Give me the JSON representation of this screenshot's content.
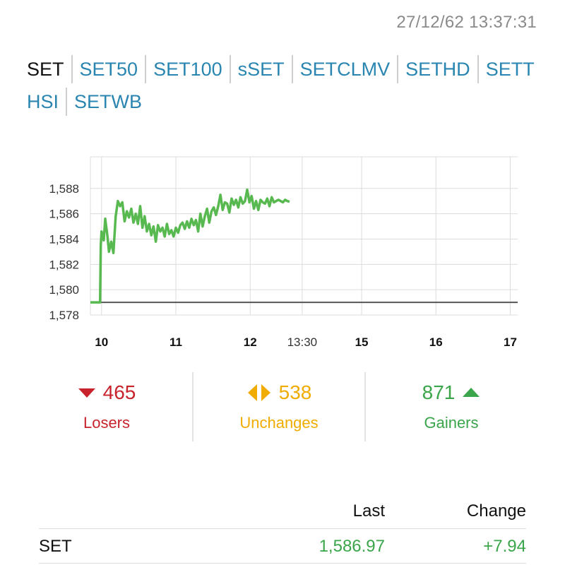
{
  "timestamp": "27/12/62 13:37:31",
  "tabs": [
    "SET",
    "SET50",
    "SET100",
    "sSET",
    "SETCLMV",
    "SETHD",
    "SETT",
    "HSI",
    "SETWB"
  ],
  "active_tab": "SET",
  "chart_data": {
    "type": "line",
    "y_ticks": [
      "1,578",
      "1,580",
      "1,582",
      "1,584",
      "1,586",
      "1,588"
    ],
    "ylim": [
      1578,
      1590.5
    ],
    "x_ticks": [
      {
        "label": "10",
        "time": 10.0,
        "bold": true
      },
      {
        "label": "11",
        "time": 11.0,
        "bold": true
      },
      {
        "label": "12",
        "time": 12.0,
        "bold": true
      },
      {
        "label": "13:30",
        "time": 12.7,
        "bold": false
      },
      {
        "label": "15",
        "time": 13.5,
        "bold": true
      },
      {
        "label": "16",
        "time": 14.5,
        "bold": true
      },
      {
        "label": "17",
        "time": 15.5,
        "bold": true
      }
    ],
    "xlim": [
      9.85,
      15.6
    ],
    "baseline": 1579.0,
    "line_color": "#57b94f",
    "series": [
      {
        "x": [
          9.85,
          9.98,
          9.99,
          10.0,
          10.03,
          10.05,
          10.08,
          10.1,
          10.13,
          10.16,
          10.19,
          10.22,
          10.25,
          10.28,
          10.31,
          10.34,
          10.37,
          10.4,
          10.43,
          10.46,
          10.49,
          10.52,
          10.55,
          10.58,
          10.61,
          10.64,
          10.67,
          10.7,
          10.73,
          10.76,
          10.79,
          10.82,
          10.85,
          10.88,
          10.91,
          10.94,
          10.97,
          11.0,
          11.03,
          11.06,
          11.09,
          11.12,
          11.15,
          11.18,
          11.21,
          11.24,
          11.27,
          11.3,
          11.33,
          11.36,
          11.39,
          11.42,
          11.45,
          11.48,
          11.51,
          11.54,
          11.57,
          11.6,
          11.63,
          11.66,
          11.69,
          11.72,
          11.75,
          11.78,
          11.81,
          11.84,
          11.87,
          11.9,
          11.93,
          11.96,
          11.99,
          12.02,
          12.05,
          12.08,
          12.11,
          12.14,
          12.17,
          12.2,
          12.23,
          12.26,
          12.29,
          12.32,
          12.35,
          12.38,
          12.41,
          12.44,
          12.47,
          12.5,
          12.53
        ],
        "y": [
          1579.0,
          1579.0,
          1583.5,
          1584.6,
          1583.9,
          1585.6,
          1584.2,
          1583.0,
          1583.8,
          1582.9,
          1585.8,
          1587.0,
          1586.6,
          1586.9,
          1585.4,
          1586.2,
          1585.7,
          1586.4,
          1585.3,
          1586.0,
          1585.2,
          1586.6,
          1584.9,
          1585.8,
          1584.6,
          1585.2,
          1584.3,
          1585.0,
          1583.8,
          1585.1,
          1584.6,
          1584.9,
          1584.2,
          1585.2,
          1584.4,
          1584.7,
          1584.2,
          1584.9,
          1584.5,
          1585.1,
          1585.3,
          1584.8,
          1585.4,
          1584.9,
          1585.6,
          1585.1,
          1585.5,
          1584.6,
          1586.0,
          1585.0,
          1585.8,
          1586.4,
          1585.3,
          1586.2,
          1586.5,
          1585.9,
          1586.6,
          1587.5,
          1586.3,
          1586.9,
          1586.8,
          1586.1,
          1587.2,
          1586.7,
          1587.1,
          1586.5,
          1587.3,
          1586.8,
          1587.0,
          1587.9,
          1586.9,
          1587.4,
          1586.4,
          1587.0,
          1586.3,
          1587.1,
          1586.9,
          1586.8,
          1587.2,
          1586.6,
          1587.3,
          1586.9,
          1587.0,
          1587.1,
          1587.0,
          1586.9,
          1587.1,
          1587.0,
          1586.95
        ]
      }
    ]
  },
  "stats": {
    "losers": {
      "value": "465",
      "label": "Losers",
      "color": "#c8232c"
    },
    "unchanges": {
      "value": "538",
      "label": "Unchanges",
      "color": "#f0ac00"
    },
    "gainers": {
      "value": "871",
      "label": "Gainers",
      "color": "#3aa54a"
    }
  },
  "table": {
    "headers": {
      "last": "Last",
      "change": "Change"
    },
    "rows": [
      {
        "name": "SET",
        "last": "1,586.97",
        "change": "+7.94"
      }
    ]
  }
}
